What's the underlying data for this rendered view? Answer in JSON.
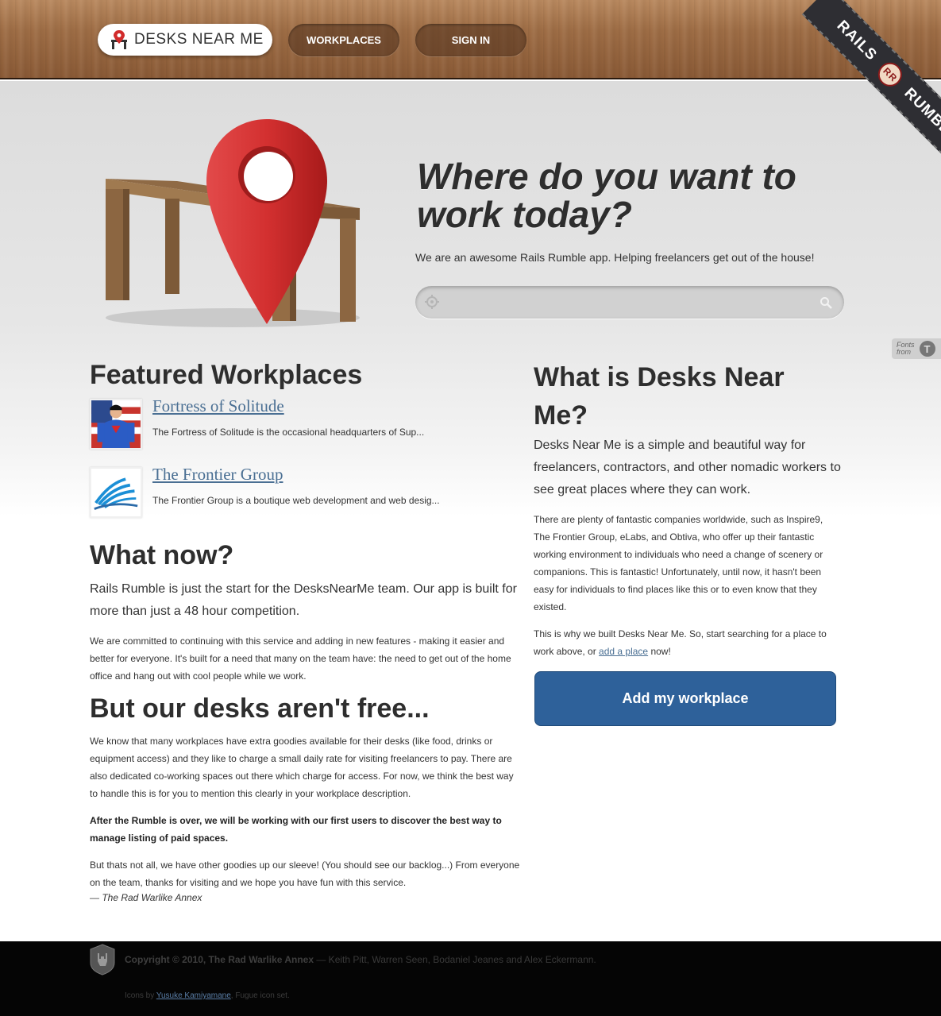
{
  "header": {
    "logo_text": "DESKS NEAR ME",
    "nav": {
      "workplaces": "WORKPLACES",
      "signin": "SIGN IN"
    },
    "ribbon": {
      "left": "RAILS",
      "badge": "RR",
      "right": "RUMBLE"
    }
  },
  "hero": {
    "title": "Where do you want to work today?",
    "subtitle": "We are an awesome Rails Rumble app. Helping freelancers get out of the house!",
    "search_placeholder": ""
  },
  "fonts_badge": {
    "line1": "Fonts",
    "line2": "from",
    "mark": "T"
  },
  "featured": {
    "title": "Featured Workplaces",
    "items": [
      {
        "name": "Fortress of Solitude",
        "description": "The Fortress of Solitude is the occasional headquarters of Sup..."
      },
      {
        "name": "The Frontier Group",
        "description": "The Frontier Group is a boutique web development and web desig..."
      }
    ]
  },
  "what_is": {
    "title": "What is Desks Near Me?",
    "lead": "Desks Near Me is a simple and beautiful way for freelancers, contractors, and other nomadic workers to see great places where they can work.",
    "p1": "There are plenty of fantastic companies worldwide, such as Inspire9, The Frontier Group, eLabs, and Obtiva, who offer up their fantastic working environment to individuals who need a change of scenery or companions. This is fantastic! Unfortunately, until now, it hasn't been easy for individuals to find places like this or to even know that they existed.",
    "p2_before": "This is why we built Desks Near Me. So, start searching for a place to work above, or ",
    "p2_link": "add a place",
    "p2_after": " now!",
    "button": "Add my workplace"
  },
  "what_now": {
    "title": "What now?",
    "lead": "Rails Rumble is just the start for the DesksNearMe team. Our app is built for more than just a 48 hour competition.",
    "p": "We are committed to continuing with this service and adding in new features - making it easier and better for everyone. It's built for a need that many on the team have: the need to get out of the home office and hang out with cool people while we work."
  },
  "not_free": {
    "title": "But our desks aren't free...",
    "p1": "We know that many workplaces have extra goodies available for their desks (like food, drinks or equipment access) and they like to charge a small daily rate for visiting freelancers to pay. There are also dedicated co-working spaces out there which charge for access. For now, we think the best way to handle this is for you to mention this clearly in your workplace description.",
    "p2": "After the Rumble is over, we will be working with our first users to discover the best way to manage listing of paid spaces.",
    "p3": "But thats not all, we have other goodies up our sleeve! (You should see our backlog...) From everyone on the team, thanks for visiting and we hope you have fun with this service.",
    "signature": "— The Rad Warlike Annex"
  },
  "footer": {
    "copyright_bold": "Copyright © 2010, The Rad Warlike Annex",
    "copyright_rest": " — Keith Pitt, Warren Seen, Bodaniel Jeanes and Alex Eckermann.",
    "icons_before": "Icons by ",
    "icons_link": "Yusuke Kamiyamane",
    "icons_after": ", Fugue icon set."
  },
  "colors": {
    "accent_button": "#2e619a",
    "link": "#4a6f93",
    "pin_red": "#c62a2a",
    "footer_bg": "#050505"
  }
}
